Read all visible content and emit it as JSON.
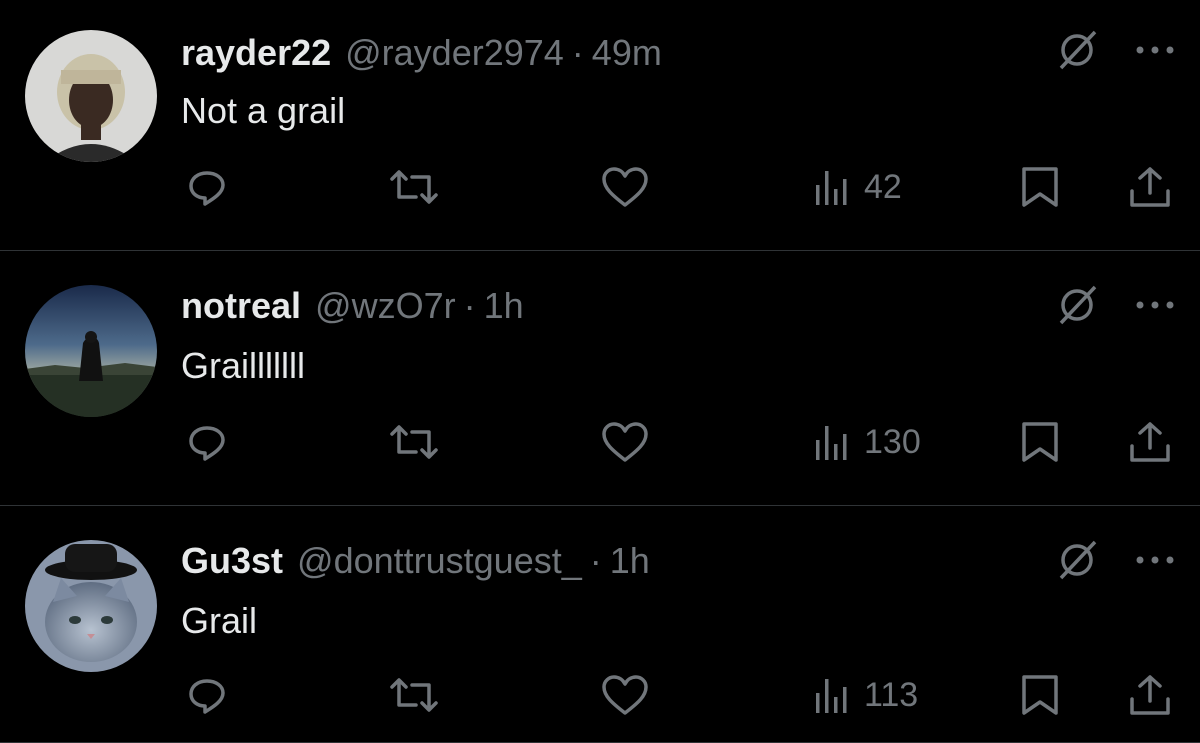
{
  "posts": [
    {
      "name": "rayder22",
      "handle": "@rayder2974",
      "separator": "·",
      "time": "49m",
      "text": "Not a grail",
      "views": "42",
      "avatar": "portrait-photo"
    },
    {
      "name": "notreal",
      "handle": "@wzO7r",
      "separator": "·",
      "time": "1h",
      "text": "Grailllllll",
      "views": "130",
      "avatar": "dusk-figure-landscape"
    },
    {
      "name": "Gu3st",
      "handle": "@donttrustguest_",
      "separator": "·",
      "time": "1h",
      "text": "Grail",
      "views": "113",
      "avatar": "cat-with-hat"
    }
  ],
  "icons": {
    "grok": "grok-icon",
    "more": "more-icon",
    "reply": "reply-icon",
    "repost": "repost-icon",
    "like": "like-icon",
    "views": "views-icon",
    "bookmark": "bookmark-icon",
    "share": "share-icon"
  },
  "colors": {
    "background": "#000000",
    "primary_text": "#e7e9ea",
    "secondary_text": "#71767b",
    "divider": "#2f3336"
  }
}
